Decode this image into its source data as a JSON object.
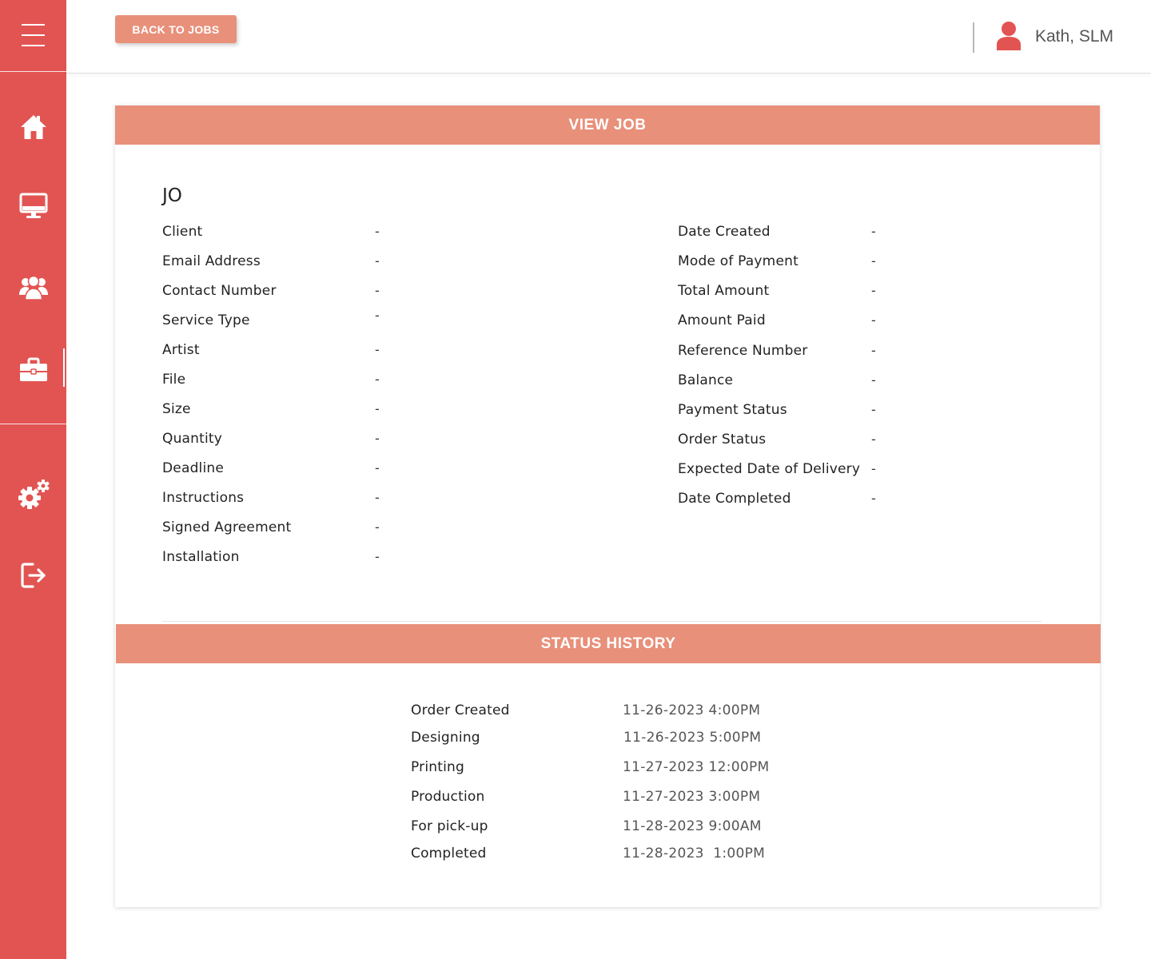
{
  "colors": {
    "sidebar": "#e25452",
    "accent": "#e8907a"
  },
  "sidebar": {
    "menu_icon": "hamburger-menu-icon",
    "items": [
      {
        "name": "home",
        "icon": "home-icon"
      },
      {
        "name": "monitor",
        "icon": "monitor-icon"
      },
      {
        "name": "clients",
        "icon": "users-icon"
      },
      {
        "name": "jobs",
        "icon": "briefcase-icon",
        "active": true
      },
      {
        "name": "settings",
        "icon": "gears-icon"
      },
      {
        "name": "logout",
        "icon": "logout-icon"
      }
    ]
  },
  "topbar": {
    "back_label": "BACK TO JOBS",
    "user_icon": "user-avatar-icon",
    "user_name": "Kath, SLM"
  },
  "view_job": {
    "header": "VIEW JOB",
    "title": "JO",
    "left_fields": [
      {
        "label": "Client",
        "value": "-"
      },
      {
        "label": "Email Address",
        "value": "-"
      },
      {
        "label": "Contact Number",
        "value": "-"
      },
      {
        "label": "Service Type",
        "value": "-"
      },
      {
        "label": "Artist",
        "value": "-"
      },
      {
        "label": "File",
        "value": "-"
      },
      {
        "label": "Size",
        "value": "-"
      },
      {
        "label": "Quantity",
        "value": "-"
      },
      {
        "label": "Deadline",
        "value": "-"
      },
      {
        "label": "Instructions",
        "value": "-"
      },
      {
        "label": "Signed Agreement",
        "value": "-"
      },
      {
        "label": "Installation",
        "value": "-"
      }
    ],
    "right_fields": [
      {
        "label": "Date Created",
        "value": "-"
      },
      {
        "label": "Mode of Payment",
        "value": "-"
      },
      {
        "label": "Total Amount",
        "value": "-"
      },
      {
        "label": "Amount Paid",
        "value": "-"
      },
      {
        "label": "Reference Number",
        "value": "-"
      },
      {
        "label": "Balance",
        "value": "-"
      },
      {
        "label": "Payment Status",
        "value": "-"
      },
      {
        "label": "Order Status",
        "value": "-"
      },
      {
        "label": "Expected Date of Delivery",
        "value": "-"
      },
      {
        "label": "Date Completed",
        "value": "-"
      }
    ]
  },
  "status_history": {
    "header": "STATUS HISTORY",
    "entries": [
      {
        "status": "Order Created",
        "time": "11-26-2023 4:00PM"
      },
      {
        "status": "Designing",
        "time": "11-26-2023 5:00PM"
      },
      {
        "status": "Printing",
        "time": "11-27-2023 12:00PM"
      },
      {
        "status": "Production",
        "time": "11-27-2023 3:00PM"
      },
      {
        "status": "For pick-up",
        "time": "11-28-2023 9:00AM"
      },
      {
        "status": "Completed",
        "time": "11-28-2023  1:00PM"
      }
    ]
  }
}
